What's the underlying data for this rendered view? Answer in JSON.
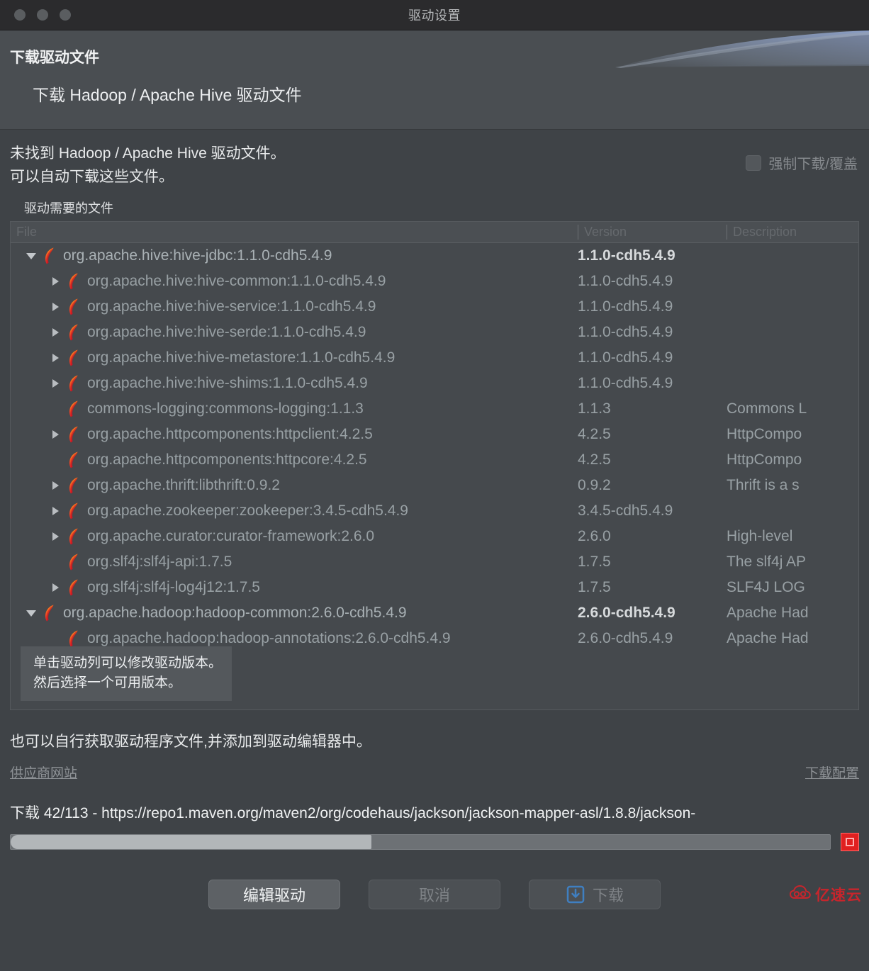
{
  "window": {
    "title": "驱动设置",
    "traffic_lights": [
      "close",
      "minimize",
      "zoom"
    ]
  },
  "header": {
    "title": "下载驱动文件",
    "subtitle": "下载 Hadoop / Apache Hive 驱动文件"
  },
  "notice": {
    "line1": "未找到 Hadoop / Apache Hive 驱动文件。",
    "line2": "可以自动下载这些文件。"
  },
  "force_download": {
    "label": "强制下载/覆盖",
    "checked": false,
    "enabled": false
  },
  "files_group_label": "驱动需要的文件",
  "table": {
    "columns": [
      "File",
      "Version",
      "Description"
    ],
    "rows": [
      {
        "indent": 0,
        "twisty": "open",
        "file": "org.apache.hive:hive-jdbc:1.1.0-cdh5.4.9",
        "version": "1.1.0-cdh5.4.9",
        "description": "",
        "bold": true
      },
      {
        "indent": 1,
        "twisty": "closed",
        "file": "org.apache.hive:hive-common:1.1.0-cdh5.4.9",
        "version": "1.1.0-cdh5.4.9",
        "description": "",
        "bold": false
      },
      {
        "indent": 1,
        "twisty": "closed",
        "file": "org.apache.hive:hive-service:1.1.0-cdh5.4.9",
        "version": "1.1.0-cdh5.4.9",
        "description": "",
        "bold": false
      },
      {
        "indent": 1,
        "twisty": "closed",
        "file": "org.apache.hive:hive-serde:1.1.0-cdh5.4.9",
        "version": "1.1.0-cdh5.4.9",
        "description": "",
        "bold": false
      },
      {
        "indent": 1,
        "twisty": "closed",
        "file": "org.apache.hive:hive-metastore:1.1.0-cdh5.4.9",
        "version": "1.1.0-cdh5.4.9",
        "description": "",
        "bold": false
      },
      {
        "indent": 1,
        "twisty": "closed",
        "file": "org.apache.hive:hive-shims:1.1.0-cdh5.4.9",
        "version": "1.1.0-cdh5.4.9",
        "description": "",
        "bold": false
      },
      {
        "indent": 1,
        "twisty": "none",
        "file": "commons-logging:commons-logging:1.1.3",
        "version": "1.1.3",
        "description": "Commons L",
        "bold": false
      },
      {
        "indent": 1,
        "twisty": "closed",
        "file": "org.apache.httpcomponents:httpclient:4.2.5",
        "version": "4.2.5",
        "description": "HttpCompo",
        "bold": false
      },
      {
        "indent": 1,
        "twisty": "none",
        "file": "org.apache.httpcomponents:httpcore:4.2.5",
        "version": "4.2.5",
        "description": "HttpCompo",
        "bold": false
      },
      {
        "indent": 1,
        "twisty": "closed",
        "file": "org.apache.thrift:libthrift:0.9.2",
        "version": "0.9.2",
        "description": "Thrift is a s",
        "bold": false
      },
      {
        "indent": 1,
        "twisty": "closed",
        "file": "org.apache.zookeeper:zookeeper:3.4.5-cdh5.4.9",
        "version": "3.4.5-cdh5.4.9",
        "description": "",
        "bold": false
      },
      {
        "indent": 1,
        "twisty": "closed",
        "file": "org.apache.curator:curator-framework:2.6.0",
        "version": "2.6.0",
        "description": "High-level ",
        "bold": false
      },
      {
        "indent": 1,
        "twisty": "none",
        "file": "org.slf4j:slf4j-api:1.7.5",
        "version": "1.7.5",
        "description": "The slf4j AP",
        "bold": false
      },
      {
        "indent": 1,
        "twisty": "closed",
        "file": "org.slf4j:slf4j-log4j12:1.7.5",
        "version": "1.7.5",
        "description": "SLF4J LOG",
        "bold": false
      },
      {
        "indent": 0,
        "twisty": "open",
        "file": "org.apache.hadoop:hadoop-common:2.6.0-cdh5.4.9",
        "version": "2.6.0-cdh5.4.9",
        "description": "Apache Had",
        "bold": true
      },
      {
        "indent": 1,
        "twisty": "none",
        "file": "org.apache.hadoop:hadoop-annotations:2.6.0-cdh5.4.9",
        "version": "2.6.0-cdh5.4.9",
        "description": "Apache Had",
        "bold": false
      },
      {
        "indent": 1,
        "twisty": "closed",
        "file": "",
        "version": "",
        "description": "",
        "bold": false
      }
    ]
  },
  "tooltip": {
    "line1": "单击驱动列可以修改驱动版本。",
    "line2": "然后选择一个可用版本。"
  },
  "footer": {
    "note": "也可以自行获取驱动程序文件,并添加到驱动编辑器中。",
    "vendor_link": "供应商网站",
    "config_link": "下载配置"
  },
  "download": {
    "status": "下载 42/113 - https://repo1.maven.org/maven2/org/codehaus/jackson/jackson-mapper-asl/1.8.8/jackson-",
    "progress_percent": 44,
    "stop_label": "stop"
  },
  "buttons": {
    "edit_driver": "编辑驱动",
    "cancel": "取消",
    "download": "下载"
  },
  "watermark": {
    "text": "亿速云"
  },
  "colors": {
    "window_bg": "#3f4347",
    "header_bg": "#4a4e52",
    "titlebar_bg": "#2b2b2d",
    "accent_blue": "#4f6ea8",
    "stop_red": "#e02020",
    "feather_orange": "#f7941e",
    "feather_red": "#d71920",
    "watermark_red": "#c8252c"
  }
}
